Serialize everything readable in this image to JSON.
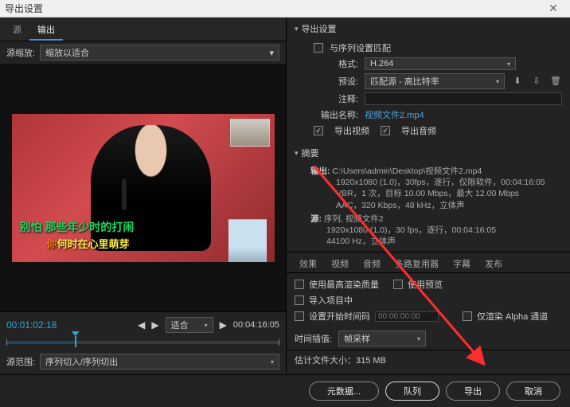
{
  "window": {
    "title": "导出设置"
  },
  "left": {
    "tabs": {
      "source": "源",
      "output": "输出"
    },
    "scale_label": "源缩放:",
    "scale_value": "缩放以适合",
    "fit_label": "适合",
    "sub_green": "别怕 那些年少时的打闹",
    "sub_yellow_a": "你",
    "sub_yellow_b": "何",
    "sub_yellow_c": "时在心里萌芽",
    "current_tc": "00:01:02:18",
    "total_tc": "00:04:16:05",
    "range_label": "源范围:",
    "range_value": "序列切入/序列切出"
  },
  "export": {
    "header": "导出设置",
    "match_sequence": "与序列设置匹配",
    "format_label": "格式:",
    "format_value": "H.264",
    "preset_label": "预设:",
    "preset_value": "匹配源 - 高比特率",
    "comment_label": "注释:",
    "output_name_label": "输出名称:",
    "output_name_value": "视频文件2.mp4",
    "export_video": "导出视频",
    "export_audio": "导出音频"
  },
  "summary": {
    "header": "摘要",
    "out_lbl": "输出:",
    "out_l1": "C:\\Users\\admin\\Desktop\\视频文件2.mp4",
    "out_l2": "1920x1080 (1.0)，30fps，逐行，仅限软件，00:04:16:05",
    "out_l3": "VBR，1 次，目标 10.00 Mbps，最大 12.00 Mbps",
    "out_l4": "AAC，320 Kbps，48 kHz，立体声",
    "src_lbl": "源:",
    "src_l1": "序列, 视频文件2",
    "src_l2": "1920x1080 (1.0)，30 fps，逐行，00:04:16:05",
    "src_l3": "44100 Hz，立体声"
  },
  "tabs2": {
    "effects": "效果",
    "video": "视频",
    "audio": "音频",
    "mux": "多路复用器",
    "caption": "字幕",
    "publish": "发布"
  },
  "opts": {
    "max_quality": "使用最高渲染质量",
    "use_preview": "使用预览",
    "import_project": "导入项目中",
    "start_tc": "设置开始时间码",
    "start_tc_val": "00:00:00:00",
    "alpha_only": "仅渲染 Alpha 通道",
    "interp_label": "时间插值:",
    "interp_value": "帧采样"
  },
  "estimate": {
    "label": "估计文件大小：",
    "value": "315 MB"
  },
  "footer": {
    "meta": "元数据...",
    "queue": "队列",
    "export": "导出",
    "cancel": "取消"
  }
}
